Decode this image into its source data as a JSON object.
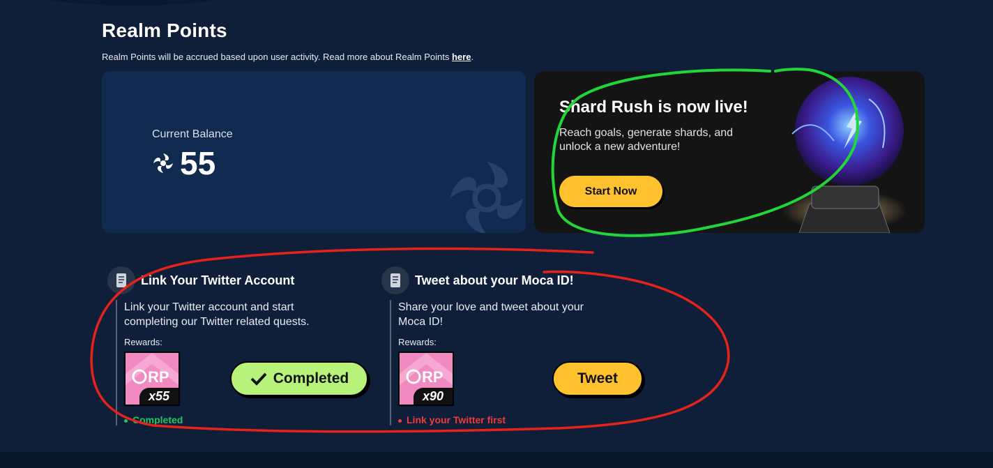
{
  "page": {
    "title": "Realm Points",
    "subtitle_prefix": "Realm Points will be accrued based upon user activity. Read more about Realm Points ",
    "subtitle_link": "here",
    "subtitle_suffix": "."
  },
  "balance": {
    "label": "Current Balance",
    "value": "55",
    "icon": "realm-swirl-icon"
  },
  "promo": {
    "title": "Shard Rush is now live!",
    "text": "Reach goals, generate shards, and unlock a new adventure!",
    "button_label": "Start Now",
    "image": "glowing-orb-pedestal"
  },
  "quests": [
    {
      "title": "Link Your Twitter Account",
      "description": "Link your Twitter account and start completing our Twitter related quests.",
      "rewards_label": "Rewards:",
      "reward_qty": "x55",
      "status": "Completed",
      "status_color": "#22c55e",
      "button_label": "Completed",
      "button_icon": "check-icon",
      "icon": "scroll-icon"
    },
    {
      "title": "Tweet about your Moca ID!",
      "description": "Share your love and tweet about your Moca ID!",
      "rewards_label": "Rewards:",
      "reward_qty": "x90",
      "status": "Link your Twitter first",
      "status_color": "#ef3b3b",
      "button_label": "Tweet",
      "icon": "scroll-icon"
    }
  ],
  "colors": {
    "background": "#0f1f3a",
    "card": "#112a50",
    "accent_yellow": "#ffc12e",
    "accent_green": "#b7f27a",
    "annotation_green": "#22d63a",
    "annotation_red": "#e5221b"
  }
}
